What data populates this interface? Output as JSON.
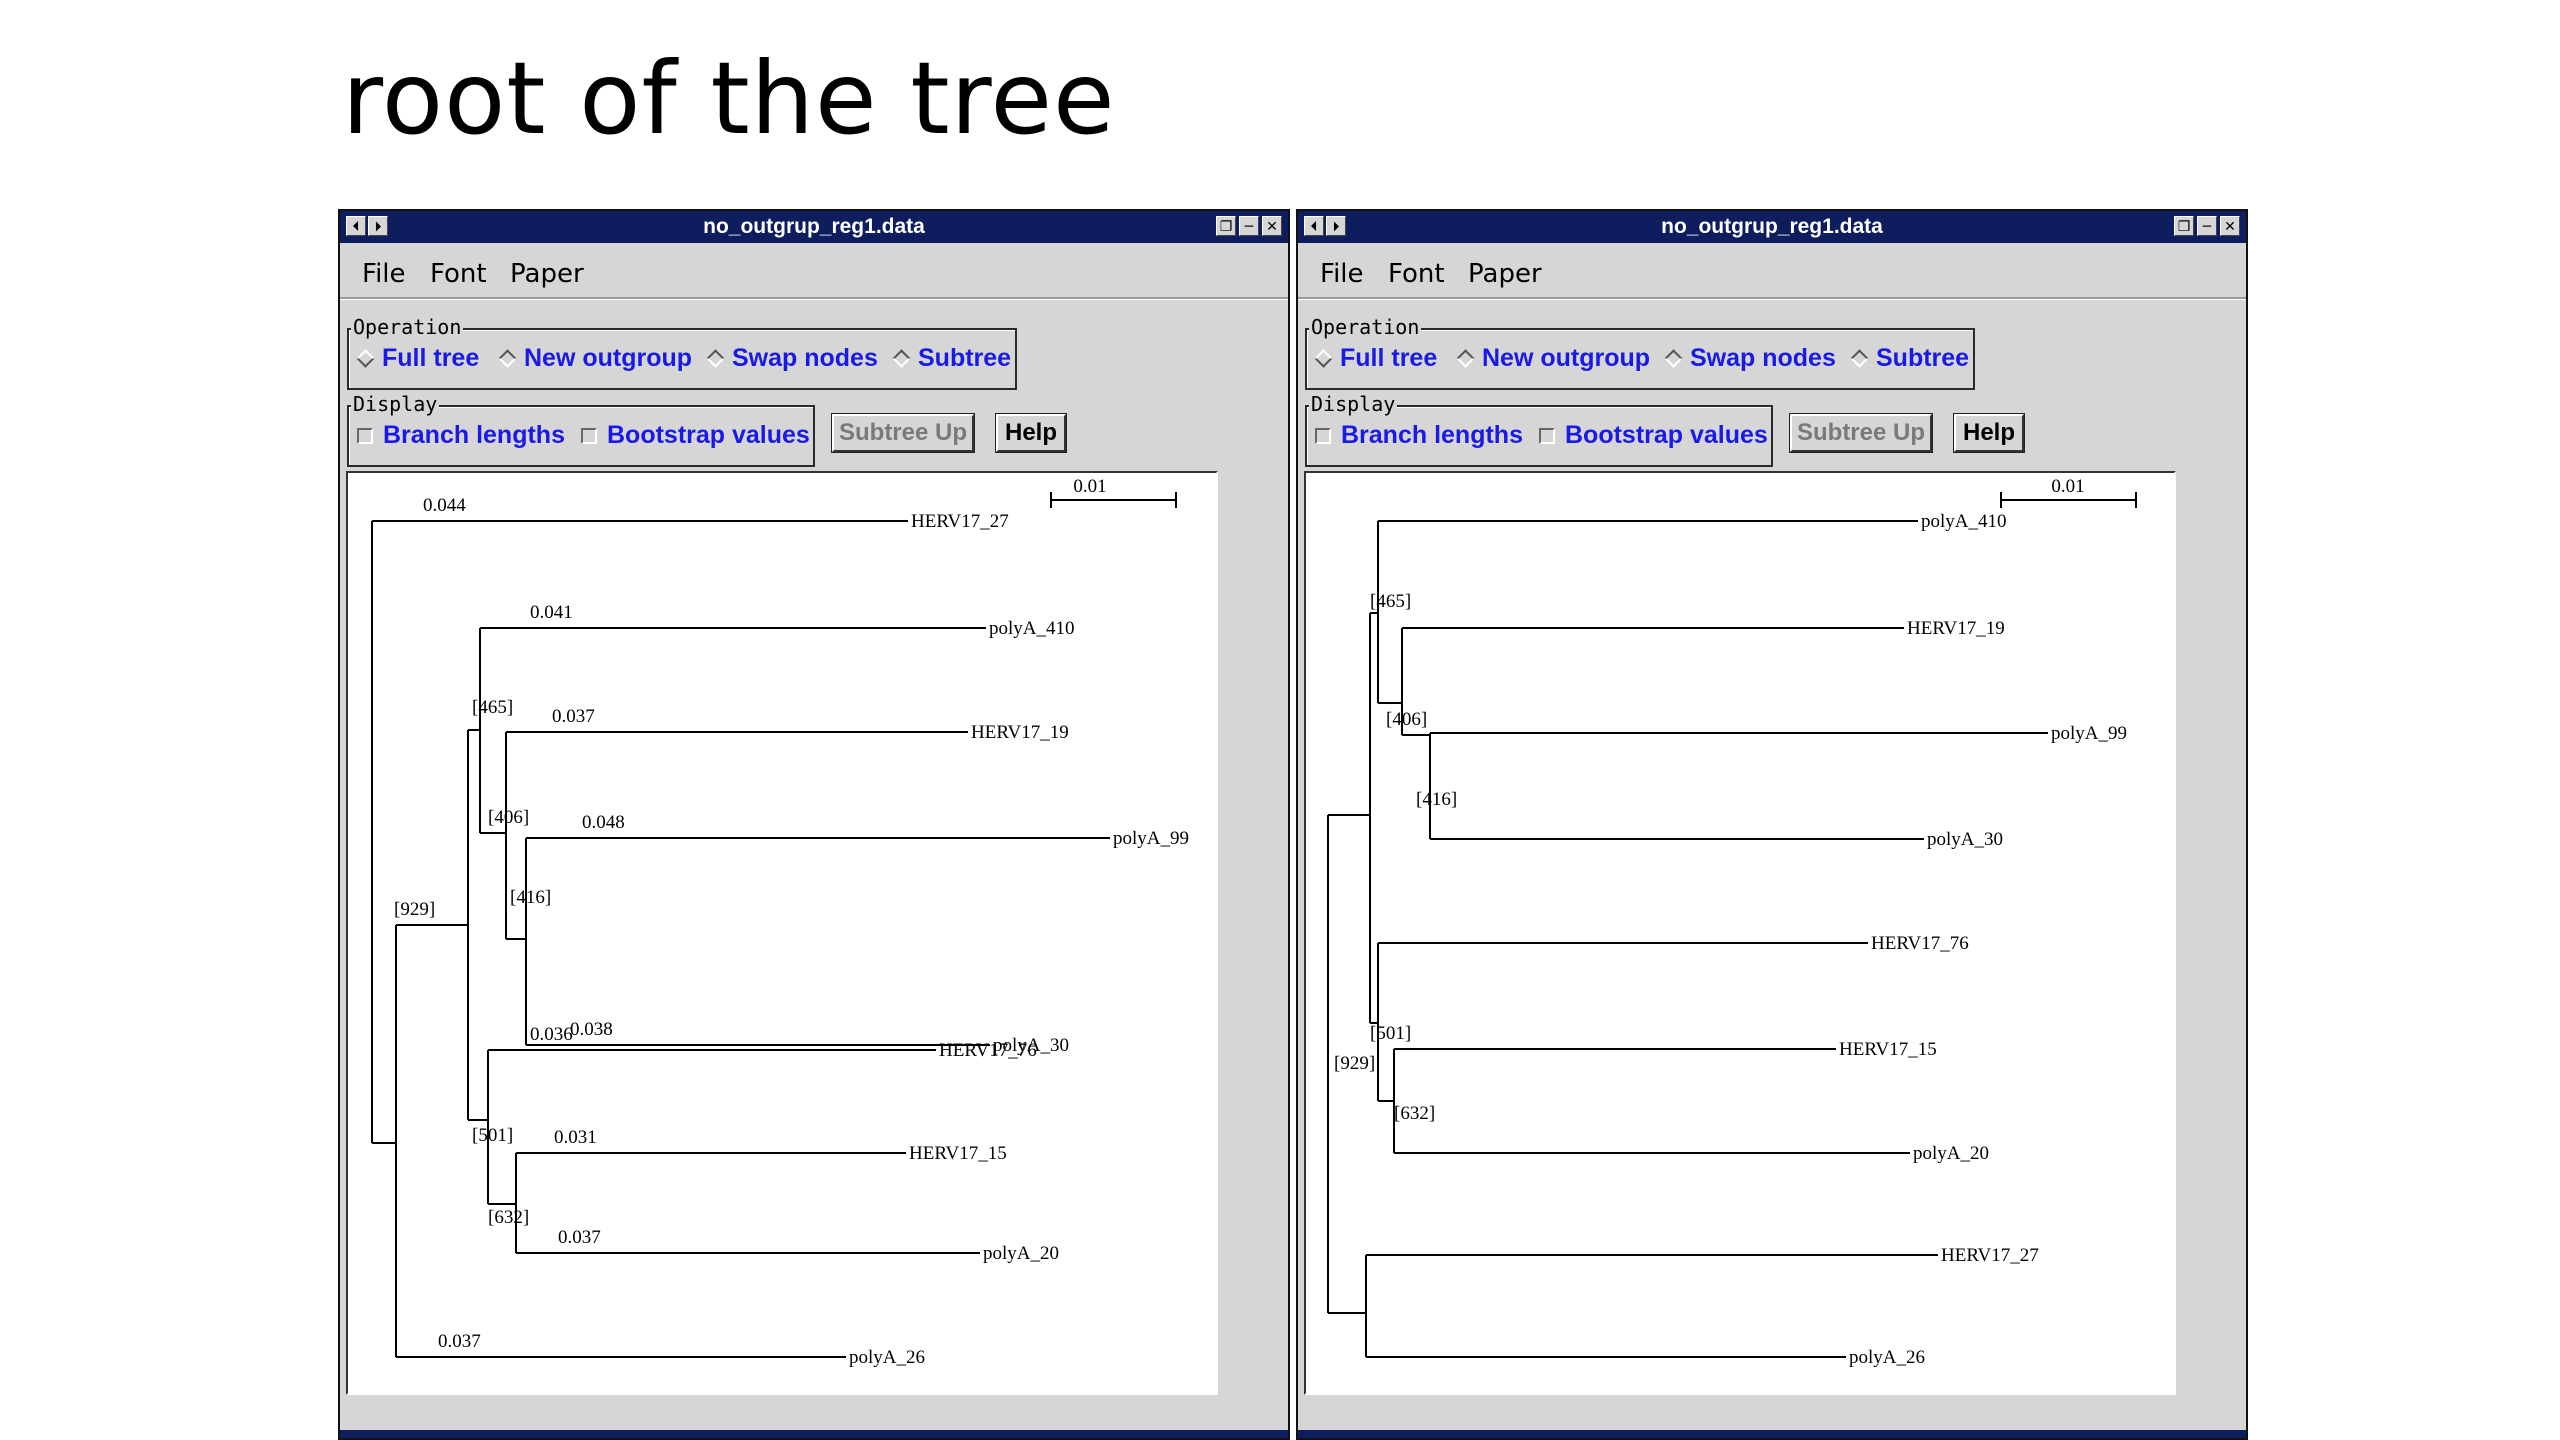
{
  "slide": {
    "title": "root of the tree"
  },
  "windows": [
    {
      "title": "no_outgrup_reg1.data",
      "titlebar_left_icons": [
        "⏴",
        "⏵"
      ],
      "titlebar_right_icons": [
        "❐",
        "─",
        "✕"
      ],
      "menu": [
        "File",
        "Font",
        "Paper"
      ],
      "operation": {
        "label": "Operation",
        "options": [
          {
            "label": "Full tree",
            "selected": true
          },
          {
            "label": "New outgroup",
            "selected": false
          },
          {
            "label": "Swap nodes",
            "selected": false
          },
          {
            "label": "Subtree",
            "selected": false
          }
        ]
      },
      "display": {
        "label": "Display",
        "options": [
          {
            "label": "Branch lengths",
            "checked": false
          },
          {
            "label": "Bootstrap values",
            "checked": false
          }
        ]
      },
      "buttons": {
        "subtree_up": "Subtree Up",
        "help": "Help"
      },
      "scale_label": "0.01",
      "tree": {
        "leaves": [
          "HERV17_27",
          "polyA_410",
          "HERV17_19",
          "polyA_99",
          "polyA_30",
          "HERV17_76",
          "HERV17_15",
          "polyA_20",
          "polyA_26"
        ],
        "branch_lengths": [
          "0.044",
          "0.041",
          "0.037",
          "0.048",
          "0.038",
          "0.036",
          "0.031",
          "0.037",
          "0.037"
        ],
        "bootstrap": [
          "[465]",
          "[406]",
          "[416]",
          "[929]",
          "[501]",
          "[632]"
        ]
      }
    },
    {
      "title": "no_outgrup_reg1.data",
      "titlebar_left_icons": [
        "⏴",
        "⏵"
      ],
      "titlebar_right_icons": [
        "❐",
        "─",
        "✕"
      ],
      "menu": [
        "File",
        "Font",
        "Paper"
      ],
      "operation": {
        "label": "Operation",
        "options": [
          {
            "label": "Full tree",
            "selected": true
          },
          {
            "label": "New outgroup",
            "selected": false
          },
          {
            "label": "Swap nodes",
            "selected": false
          },
          {
            "label": "Subtree",
            "selected": false
          }
        ]
      },
      "display": {
        "label": "Display",
        "options": [
          {
            "label": "Branch lengths",
            "checked": false
          },
          {
            "label": "Bootstrap values",
            "checked": false
          }
        ]
      },
      "buttons": {
        "subtree_up": "Subtree Up",
        "help": "Help"
      },
      "scale_label": "0.01",
      "tree": {
        "leaves": [
          "polyA_410",
          "HERV17_19",
          "polyA_99",
          "polyA_30",
          "HERV17_76",
          "HERV17_15",
          "polyA_20",
          "HERV17_27",
          "polyA_26"
        ],
        "bootstrap": [
          "[465]",
          "[406]",
          "[416]",
          "[501]",
          "[929]",
          "[632]"
        ]
      }
    }
  ]
}
